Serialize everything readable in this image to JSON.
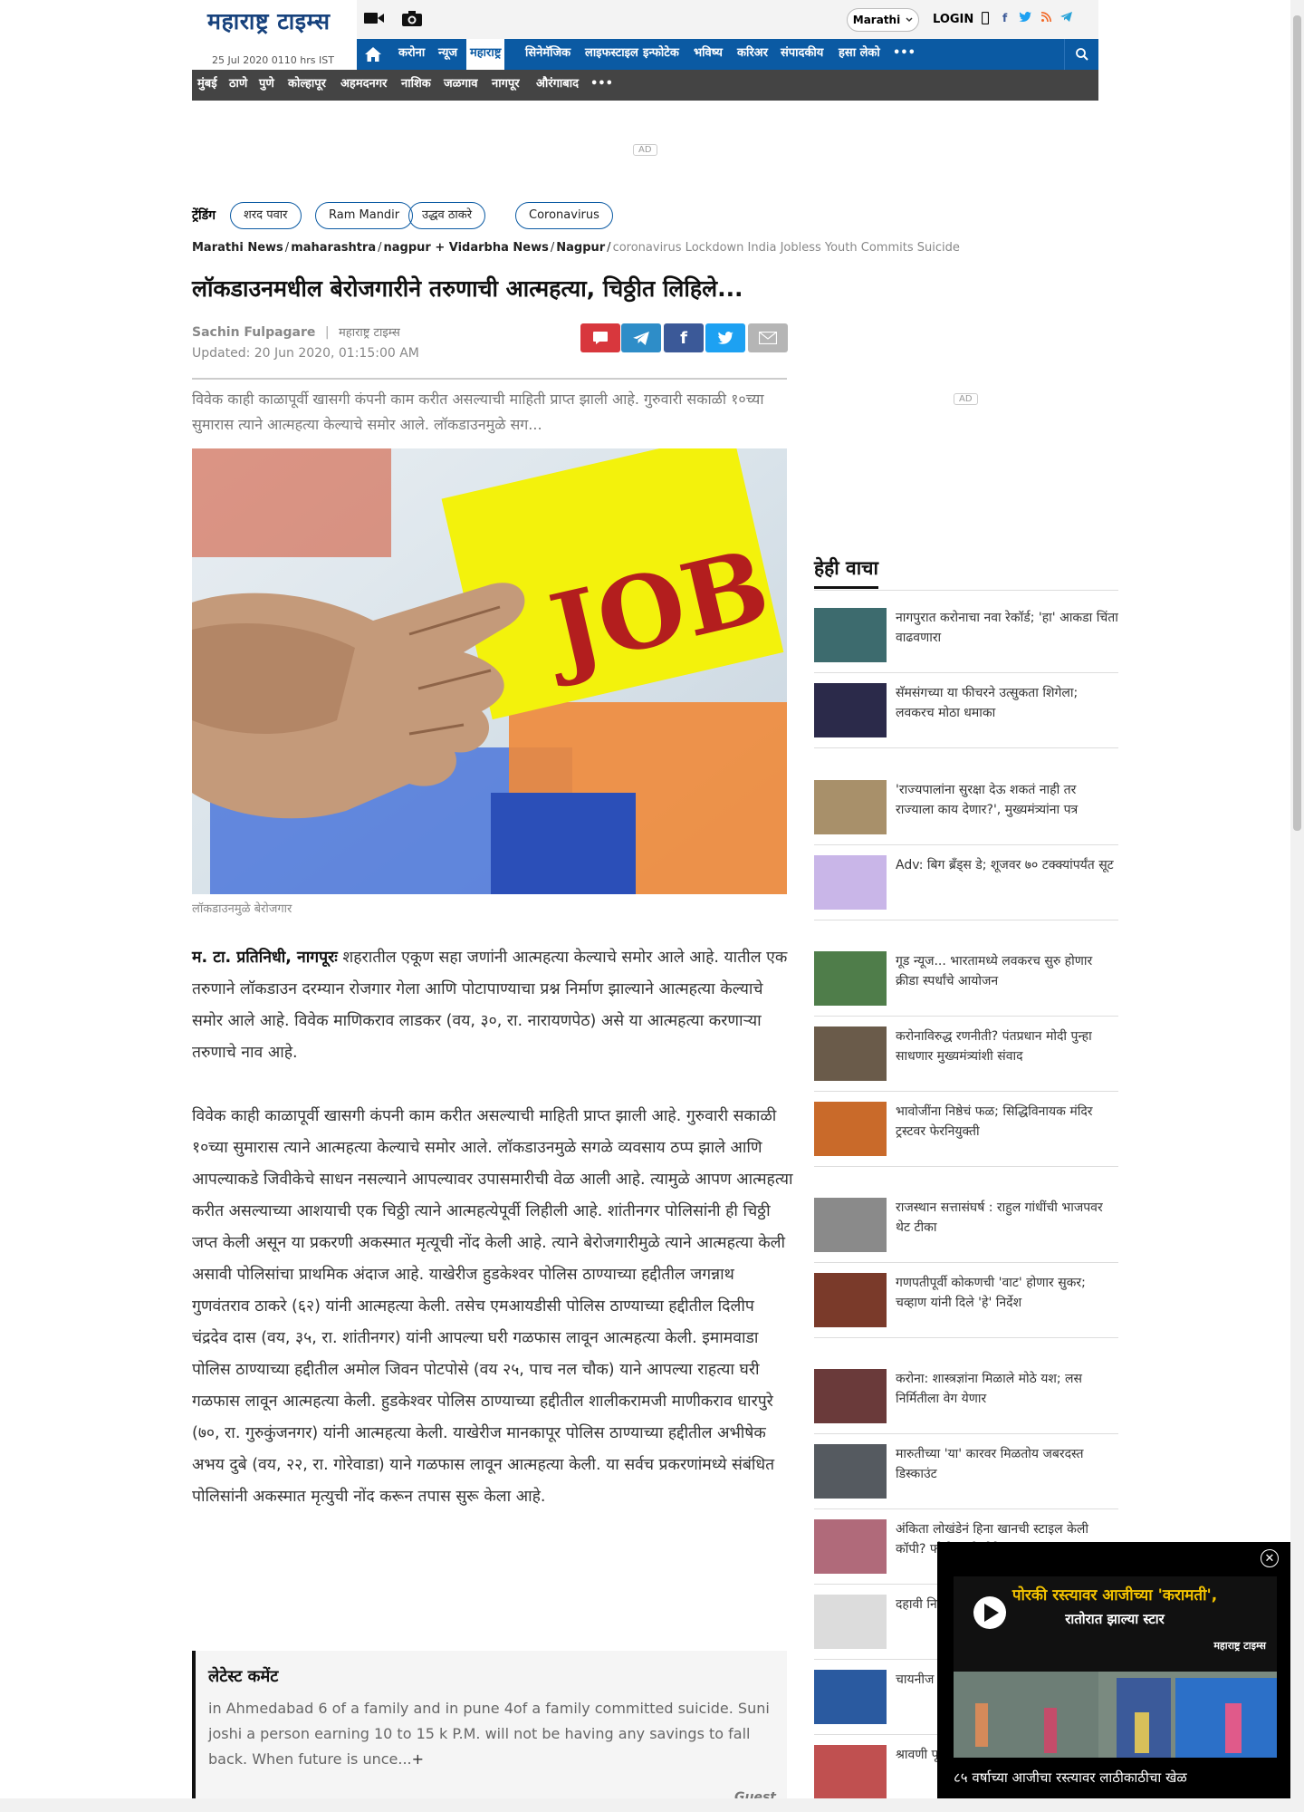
{
  "header": {
    "logo": "महाराष्ट्र टाइम्स",
    "date": "25 Jul 2020 0110 hrs IST",
    "language": "Marathi",
    "login": "LOGIN",
    "nav": [
      "करोना",
      "न्यूज",
      "महाराष्ट्र",
      "सिनेमॅजिक",
      "लाइफस्टाइल",
      "इन्फोटेक",
      "भविष्य",
      "करिअर",
      "संपादकीय",
      "हसा लेको"
    ],
    "active_nav": "महाराष्ट्र",
    "cities": [
      "मुंबई",
      "ठाणे",
      "पुणे",
      "कोल्हापूर",
      "अहमदनगर",
      "नाशिक",
      "जळगाव",
      "नागपूर",
      "औरंगाबाद"
    ],
    "more": "•••"
  },
  "ads": {
    "label": "AD"
  },
  "trending": {
    "label": "ट्रेंडिंग",
    "items": [
      "शरद पवार",
      "Ram Mandir",
      "उद्धव ठाकरे",
      "Coronavirus"
    ]
  },
  "breadcrumb": [
    "Marathi News",
    "maharashtra",
    "nagpur + Vidarbha News",
    "Nagpur",
    "coronavirus Lockdown India Jobless Youth Commits Suicide"
  ],
  "article": {
    "headline": "लॉकडाउनमधील बेरोजगारीने तरुणाची आत्महत्या, चिठ्ठीत लिहिले...",
    "author": "Sachin Fulpagare",
    "publication": "महाराष्ट्र टाइम्स",
    "updated": "Updated: 20 Jun 2020, 01:15:00 AM",
    "summary": "विवेक काही काळापूर्वी खासगी कंपनी काम करीत असल्याची माहिती प्राप्त झाली आहे. गुरुवारी सकाळी १०च्या सुमारास त्याने आत्महत्या केल्याचे समोर आले. लॉकडाउनमुळे सग...",
    "image_text": "JOB",
    "caption": "लॉकडाउनमुळे बेरोजगार",
    "para1_lead": "म. टा. प्रतिनिधी, नागपूरः",
    "para1": " शहरातील एकूण सहा जणांनी आत्महत्या केल्याचे समोर आले आहे. यातील एक तरुणाने लॉकडाउन दरम्यान रोजगार गेला आणि पोटापाण्याचा प्रश्न निर्माण झाल्याने आत्महत्या केल्याचे समोर आले आहे. विवेक माणिकराव लाडकर (वय, ३०, रा. नारायणपेठ) असे या आत्महत्या करणाऱ्या तरुणाचे नाव आहे.",
    "para2": "विवेक काही काळापूर्वी खासगी कंपनी काम करीत असल्याची माहिती प्राप्त झाली आहे. गुरुवारी सकाळी १०च्या सुमारास त्याने आत्महत्या केल्याचे समोर आले. लॉकडाउनमुळे सगळे व्यवसाय ठप्प झाले आणि आपल्याकडे जिवीकेचे साधन नसल्याने आपल्यावर उपासमारीची वेळ आली आहे. त्यामुळे आपण आत्महत्या करीत असल्याच्या आशयाची एक चिठ्ठी त्याने आत्महत्येपूर्वी लिहीली आहे. शांतीनगर पोलिसांनी ही चिठ्ठी जप्त केली असून या प्रकरणी अकस्मात मृत्यूची नोंद केली आहे. त्याने बेरोजगारीमुळे त्याने आत्महत्या केली असावी पोलिसांचा प्राथमिक अंदाज आहे. याखेरीज हुडकेश्वर पोलिस ठाण्याच्या हद्दीतील जगन्नाथ गुणवंतराव ठाकरे (६२) यांनी आत्महत्या केली. तसेच एमआयडीसी पोलिस ठाण्याच्या हद्दीतील दिलीप चंद्रदेव दास (वय, ३५, रा. शांतीनगर) यांनी आपल्या घरी गळफास लावून आत्महत्या केली. इमामवाडा पोलिस ठाण्याच्या हद्दीतील अमोल जिवन पोटपोसे (वय २५, पाच नल चौक) याने आपल्या राहत्या घरी गळफास लावून आत्महत्या केली. हुडकेश्वर पोलिस ठाण्याच्या हद्दीतील शालीकरामजी माणीकराव धारपुरे (७०, रा. गुरुकुंजनगर) यांनी आत्महत्या केली. याखेरीज मानकापूर पोलिस ठाण्याच्या हद्दीतील अभीषेक अभय दुबे (वय, २२, रा. गोरेवाडा) याने गळफास लावून आत्महत्या केली. या सर्वच प्रकरणांमध्ये संबंधित पोलिसांनी अकस्मात मृत्युची नोंद करून तपास सुरू केला आहे."
  },
  "comments": {
    "title": "लेटेस्ट कमेंट",
    "text": "in Ahmedabad 6 of a family and in pune 4of a family committed suicide. Suni joshi a person earning 10 to 15 k P.M. will not be having any savings to fall back. When future is unce...",
    "more": "+",
    "author": "Guest"
  },
  "sidebar": {
    "title": "हेही वाचा",
    "items": [
      {
        "text": "नागपुरात करोनाचा नवा रेकॉर्ड; 'हा' आकडा चिंता वाढवणारा",
        "color": "#3d6b6e"
      },
      {
        "text": "सॅमसंगच्या या फीचरने उत्सुकता शिगेला; लवकरच मोठा धमाका",
        "color": "#2b2a4a"
      },
      {
        "text": "'राज्यपालांना सुरक्षा देऊ शकतं नाही तर राज्याला काय देणार?', मुख्यमंत्र्यांना पत्र",
        "color": "#a8906a"
      },
      {
        "text": "Adv: बिग ब्रँड्स डे; शूजवर ७० टक्क्यांपर्यंत सूट",
        "color": "#c9b6e8"
      },
      {
        "text": "गूड न्यूज... भारतामध्ये लवकरच सुरु होणार क्रीडा स्पर्धांचे आयोजन",
        "color": "#4f7d4a"
      },
      {
        "text": "करोनाविरुद्ध रणनीती? पंतप्रधान मोदी पुन्हा साधणार मुख्यमंत्र्यांशी संवाद",
        "color": "#6a5b4a"
      },
      {
        "text": "भावोजींना निष्ठेचं फळ; सिद्धिविनायक मंदिर ट्रस्टवर फेरनियुक्ती",
        "color": "#c96a2a"
      },
      {
        "text": "राजस्थान सत्तासंघर्ष : राहुल गांधींची भाजपवर थेट टीका",
        "color": "#8a8a8a"
      },
      {
        "text": "गणपतीपूर्वी कोकणची 'वाट' होणार सुकर; चव्हाण यांनी दिले 'हे' निर्देश",
        "color": "#7a3a2a"
      },
      {
        "text": "करोना: शास्त्रज्ञांना मिळाले मोठे यश; लस निर्मितीला वेग येणार",
        "color": "#6a3a3a"
      },
      {
        "text": "मारुतीच्या 'या' कारवर मिळतोय जबरदस्त डिस्काउंट",
        "color": "#555a60"
      },
      {
        "text": "अंकिता लोखंडेनं हिना खानची स्टाइल केली कॉपी? फोटो झाले होते व्हायरल",
        "color": "#b06a7a"
      },
      {
        "text": "दहावी निकाल प्रतीक्षा",
        "color": "#dcdcdc"
      },
      {
        "text": "चायनीज सॅमसंग",
        "color": "#2a5aa0"
      },
      {
        "text": "श्रावणी पूजाविधी",
        "color": "#c05050"
      }
    ]
  },
  "video": {
    "headline_1": "पोरकी रस्त्यावर आजीच्या",
    "headline_2": "'करामती',",
    "headline_3": "रातोरात झाल्या स्टार",
    "brand": "महाराष्ट्र टाइम्स",
    "caption": "८५ वर्षाच्या आजीचा रस्त्यावर लाठीकाठीचा खेळ"
  }
}
